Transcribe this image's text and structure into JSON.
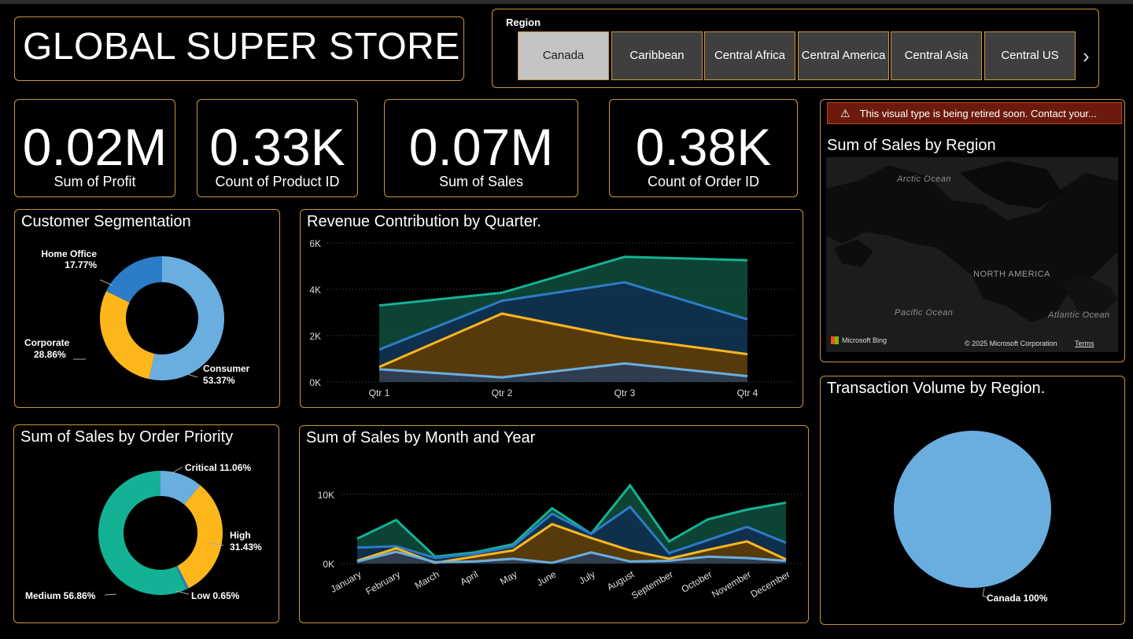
{
  "title": "GLOBAL SUPER STORE",
  "region_slicer": {
    "label": "Region",
    "items": [
      "Canada",
      "Caribbean",
      "Central Africa",
      "Central America",
      "Central Asia",
      "Central US"
    ],
    "selected": "Canada"
  },
  "kpis": [
    {
      "value": "0.02M",
      "label": "Sum of Profit"
    },
    {
      "value": "0.33K",
      "label": "Count of Product ID"
    },
    {
      "value": "0.07M",
      "label": "Sum of Sales"
    },
    {
      "value": "0.38K",
      "label": "Count of Order ID"
    }
  ],
  "map_visual": {
    "warning": "This visual type is being retired soon. Contact your...",
    "title": "Sum of Sales by Region",
    "labels": {
      "arctic": "Arctic Ocean",
      "north_america": "NORTH AMERICA",
      "pacific": "Pacific Ocean",
      "atlantic": "Atlantic Ocean"
    },
    "bing": "Microsoft Bing",
    "copyright": "© 2025 Microsoft Corporation",
    "terms": "Terms"
  },
  "colors": {
    "border": "#c8963e",
    "consumer": "#6aaee0",
    "corporate": "#fdb71b",
    "home_office": "#2c7cc7",
    "medium": "#14b294",
    "teal": "#14b294",
    "teal_fill": "#0e4a3a",
    "blue": "#2c7cc7",
    "blue_fill": "#0f2f4f",
    "gold": "#fdb71b",
    "gold_fill": "#5e3c05",
    "light": "#6aaee0",
    "light_fill": "#2c3e57",
    "pie": "#6aaee0"
  },
  "chart_data": [
    {
      "type": "pie",
      "title": "Customer Segmentation",
      "donut": true,
      "slices": [
        {
          "label": "Consumer",
          "pct_text": "53.37%",
          "value": 53.37
        },
        {
          "label": "Corporate",
          "pct_text": "28.86%",
          "value": 28.86
        },
        {
          "label": "Home Office",
          "pct_text": "17.77%",
          "value": 17.77
        }
      ]
    },
    {
      "type": "area",
      "title": "Revenue Contribution by Quarter.",
      "categories": [
        "Qtr 1",
        "Qtr 2",
        "Qtr 3",
        "Qtr 4"
      ],
      "yticks": [
        "0K",
        "2K",
        "4K",
        "6K"
      ],
      "ylim": [
        0,
        6000
      ],
      "series": [
        {
          "values": [
            3300,
            3850,
            5400,
            5250
          ]
        },
        {
          "values": [
            1400,
            3500,
            4300,
            2700
          ]
        },
        {
          "values": [
            650,
            2950,
            1900,
            1200
          ]
        },
        {
          "values": [
            550,
            200,
            800,
            250
          ]
        }
      ]
    },
    {
      "type": "pie",
      "title": "Sum of Sales by Order Priority",
      "donut": true,
      "slices": [
        {
          "label": "Critical",
          "text": "Critical 11.06%",
          "value": 11.06
        },
        {
          "label": "High",
          "text": "High",
          "pct_text": "31.43%",
          "value": 31.43
        },
        {
          "label": "Low",
          "text": "Low 0.65%",
          "value": 0.65
        },
        {
          "label": "Medium",
          "text": "Medium 56.86%",
          "value": 56.86
        }
      ]
    },
    {
      "type": "area",
      "title": "Sum of Sales by Month and Year",
      "categories": [
        "January",
        "February",
        "March",
        "April",
        "May",
        "June",
        "July",
        "August",
        "September",
        "October",
        "November",
        "December"
      ],
      "yticks": [
        "0K",
        "10K"
      ],
      "ylim": [
        0,
        10000
      ],
      "series": [
        {
          "values": [
            3600,
            6300,
            1000,
            1600,
            2800,
            8000,
            4300,
            11300,
            3200,
            6400,
            7800,
            8800
          ]
        },
        {
          "values": [
            2300,
            2500,
            800,
            1400,
            2500,
            7200,
            4300,
            8200,
            1500,
            3400,
            5300,
            3000
          ]
        },
        {
          "values": [
            400,
            2200,
            100,
            1000,
            1900,
            5700,
            3700,
            1900,
            700,
            2000,
            3200,
            600
          ]
        },
        {
          "values": [
            300,
            1700,
            200,
            300,
            700,
            100,
            1600,
            300,
            400,
            1000,
            800,
            400
          ]
        }
      ]
    },
    {
      "type": "pie",
      "title": "Transaction Volume by Region.",
      "slices": [
        {
          "label": "Canada",
          "text": "Canada 100%",
          "value": 100
        }
      ]
    }
  ]
}
